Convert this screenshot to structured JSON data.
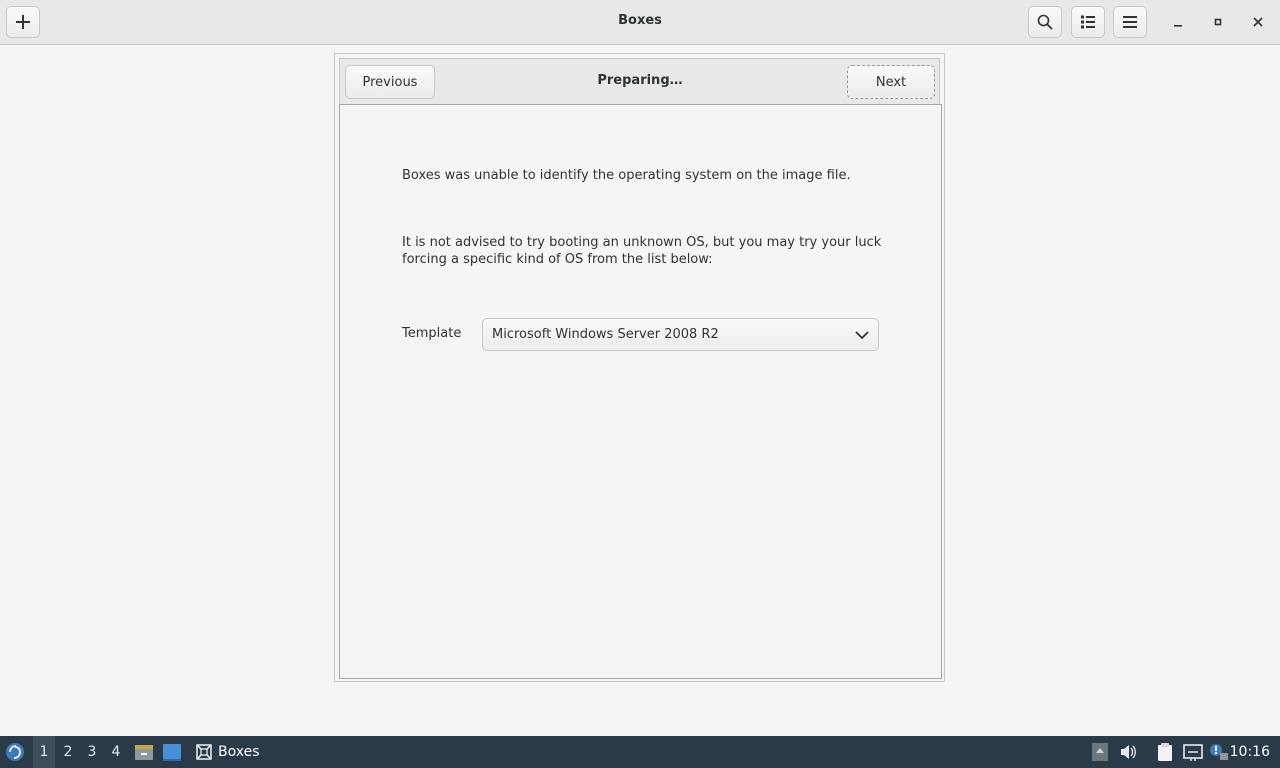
{
  "window": {
    "title": "Boxes",
    "new_icon": "plus-icon",
    "search_icon": "search-icon",
    "view_icon": "list-view-icon",
    "menu_icon": "hamburger-menu-icon"
  },
  "dialog": {
    "previous_label": "Previous",
    "title": "Preparing…",
    "next_label": "Next",
    "message1": "Boxes was unable to identify the operating system on the image file.",
    "message2": "It is not advised to try booting an unknown OS, but you may try your luck forcing a specific kind of OS from the list below:",
    "template_label": "Template",
    "template_value": "Microsoft Windows Server 2008 R2"
  },
  "taskbar": {
    "workspaces": [
      "1",
      "2",
      "3",
      "4"
    ],
    "active_workspace": "1",
    "app_label": "Boxes",
    "clock": "10:16"
  }
}
